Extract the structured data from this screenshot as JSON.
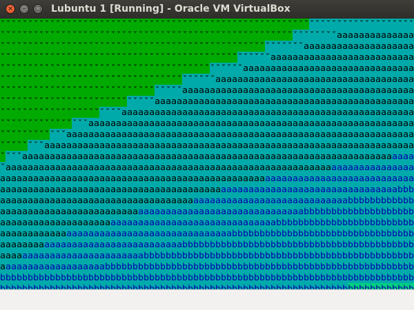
{
  "window": {
    "title": "Lubuntu 1 [Running] - Oracle VM VirtualBox",
    "close_glyph": "×",
    "minimize_glyph": "–",
    "maximize_glyph": "□"
  },
  "screen": {
    "glyphs": {
      "ground": "ˇ",
      "water": "a",
      "deep": "b"
    },
    "colors": {
      "cyan": "#00aaaa",
      "green": "#00aa00",
      "black": "#000000",
      "blue": "#0000aa",
      "bright_green": "#00d080"
    },
    "cols": 75,
    "rows": 25,
    "zones": [
      [
        56,
        75,
        75,
        75
      ],
      [
        53,
        61,
        75,
        75
      ],
      [
        48,
        55,
        75,
        75
      ],
      [
        43,
        49,
        75,
        75
      ],
      [
        38,
        44,
        75,
        75
      ],
      [
        33,
        39,
        75,
        75
      ],
      [
        28,
        33,
        75,
        75
      ],
      [
        23,
        28,
        75,
        75
      ],
      [
        18,
        22,
        75,
        75
      ],
      [
        13,
        16,
        75,
        75
      ],
      [
        9,
        12,
        75,
        75
      ],
      [
        5,
        8,
        75,
        75
      ],
      [
        1,
        4,
        71,
        75
      ],
      [
        0,
        1,
        60,
        75
      ],
      [
        0,
        0,
        48,
        75
      ],
      [
        0,
        0,
        40,
        72
      ],
      [
        0,
        0,
        35,
        63
      ],
      [
        0,
        0,
        25,
        55
      ],
      [
        0,
        0,
        20,
        50
      ],
      [
        0,
        0,
        12,
        42
      ],
      [
        0,
        0,
        8,
        33
      ],
      [
        0,
        0,
        4,
        26
      ],
      [
        0,
        0,
        1,
        19
      ],
      [
        0,
        0,
        0,
        0
      ],
      [
        0,
        0,
        0,
        0
      ]
    ],
    "row24_bright_green_from": 63
  }
}
